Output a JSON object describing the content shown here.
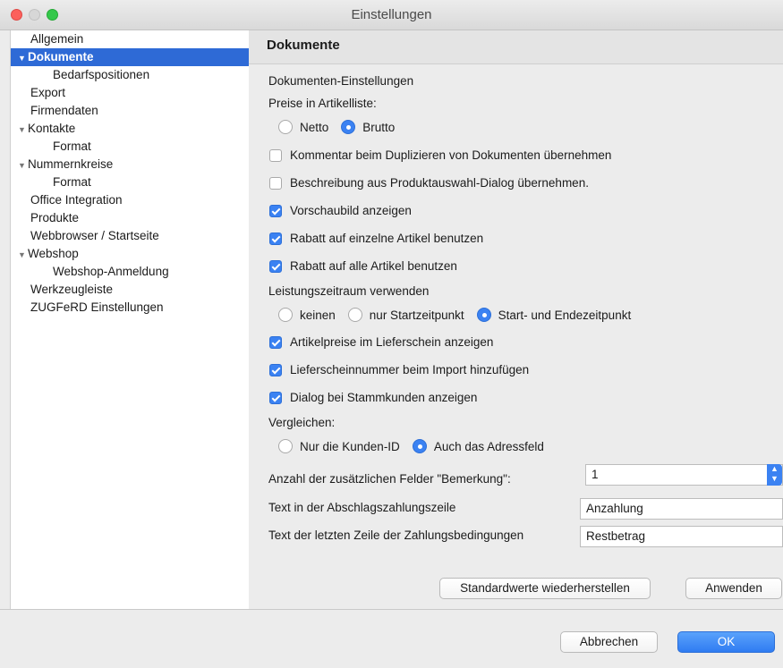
{
  "window": {
    "title": "Einstellungen"
  },
  "sidebar": {
    "items": [
      {
        "label": "Allgemein",
        "indent": 0,
        "tri": ""
      },
      {
        "label": "Dokumente",
        "indent": 0,
        "tri": "▼",
        "selected": true
      },
      {
        "label": "Bedarfspositionen",
        "indent": 2,
        "tri": ""
      },
      {
        "label": "Export",
        "indent": 0,
        "tri": ""
      },
      {
        "label": "Firmendaten",
        "indent": 0,
        "tri": ""
      },
      {
        "label": "Kontakte",
        "indent": 0,
        "tri": "▼"
      },
      {
        "label": "Format",
        "indent": 2,
        "tri": ""
      },
      {
        "label": "Nummernkreise",
        "indent": 0,
        "tri": "▼"
      },
      {
        "label": "Format",
        "indent": 2,
        "tri": ""
      },
      {
        "label": "Office Integration",
        "indent": 0,
        "tri": ""
      },
      {
        "label": "Produkte",
        "indent": 0,
        "tri": ""
      },
      {
        "label": "Webbrowser / Startseite",
        "indent": 0,
        "tri": ""
      },
      {
        "label": "Webshop",
        "indent": 0,
        "tri": "▼"
      },
      {
        "label": "Webshop-Anmeldung",
        "indent": 2,
        "tri": ""
      },
      {
        "label": "Werkzeugleiste",
        "indent": 0,
        "tri": ""
      },
      {
        "label": "ZUGFeRD Einstellungen",
        "indent": 0,
        "tri": ""
      }
    ]
  },
  "content": {
    "header": "Dokumente",
    "section_title": "Dokumenten-Einstellungen",
    "prices_label": "Preise in Artikelliste:",
    "prices_options": [
      {
        "label": "Netto",
        "checked": false
      },
      {
        "label": "Brutto",
        "checked": true
      }
    ],
    "checkboxes_a": [
      {
        "label": "Kommentar beim Duplizieren von Dokumenten übernehmen",
        "checked": false
      },
      {
        "label": "Beschreibung aus Produktauswahl-Dialog übernehmen.",
        "checked": false
      },
      {
        "label": "Vorschaubild anzeigen",
        "checked": true
      },
      {
        "label": "Rabatt auf einzelne Artikel benutzen",
        "checked": true
      },
      {
        "label": "Rabatt auf alle Artikel benutzen",
        "checked": true
      }
    ],
    "period_label": "Leistungszeitraum verwenden",
    "period_options": [
      {
        "label": "keinen",
        "checked": false
      },
      {
        "label": "nur Startzeitpunkt",
        "checked": false
      },
      {
        "label": "Start- und Endezeitpunkt",
        "checked": true
      }
    ],
    "checkboxes_b": [
      {
        "label": "Artikelpreise im Lieferschein anzeigen",
        "checked": true
      },
      {
        "label": "Lieferscheinnummer beim Import hinzufügen",
        "checked": true
      },
      {
        "label": "Dialog bei Stammkunden anzeigen",
        "checked": true
      }
    ],
    "compare_label": "Vergleichen:",
    "compare_options": [
      {
        "label": "Nur die Kunden-ID",
        "checked": false
      },
      {
        "label": "Auch das Adressfeld",
        "checked": true
      }
    ],
    "remarks_label": "Anzahl der zusätzlichen Felder \"Bemerkung\":",
    "remarks_value": "1",
    "advance_label": "Text in der Abschlagszahlungszeile",
    "advance_value": "Anzahlung",
    "lastline_label": "Text der letzten Zeile der Zahlungsbedingungen",
    "lastline_value": "Restbetrag",
    "restore_label": "Standardwerte wiederherstellen",
    "apply_label": "Anwenden"
  },
  "footer": {
    "cancel_label": "Abbrechen",
    "ok_label": "OK"
  },
  "colors": {
    "accent": "#3b82f2",
    "selection": "#2e6ad6"
  }
}
